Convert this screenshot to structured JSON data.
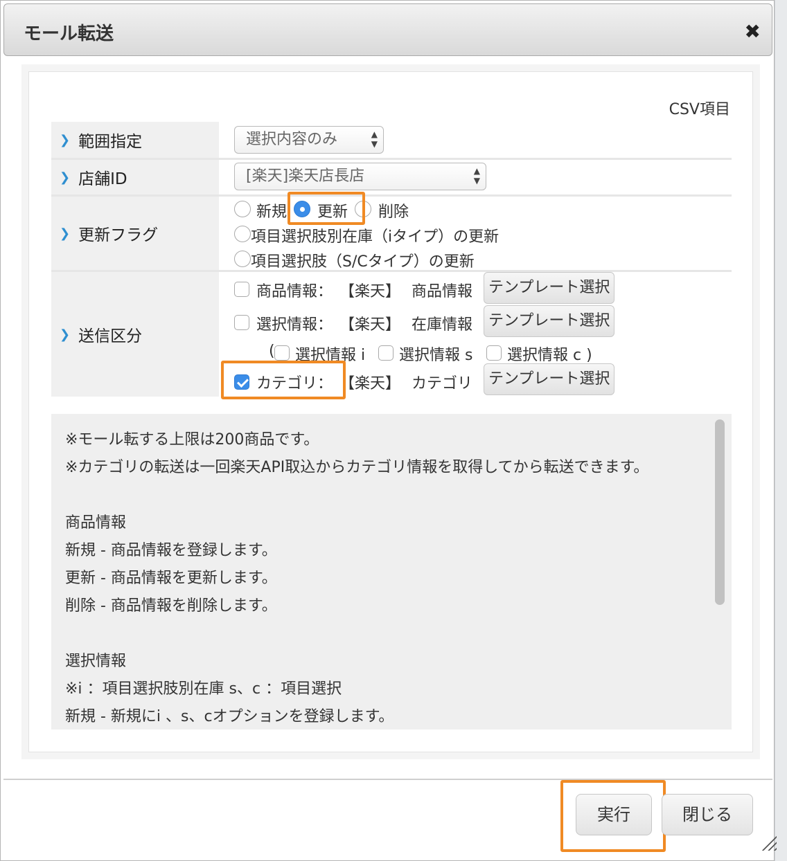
{
  "dialog": {
    "title": "モール転送",
    "close_icon": "close-icon"
  },
  "csv_label": "CSV項目",
  "form": {
    "range": {
      "label": "範囲指定",
      "value": "選択内容のみ"
    },
    "store": {
      "label": "店舗ID",
      "value": "[楽天]楽天店長店"
    },
    "update_flag": {
      "label": "更新フラグ",
      "options": [
        "新規",
        "更新",
        "削除",
        "項目選択肢別在庫（iタイプ）の更新",
        "項目選択肢（S/Cタイプ）の更新"
      ],
      "selected": "更新"
    },
    "send_type": {
      "label": "送信区分",
      "product": {
        "label": "商品情報：",
        "mall": "【楽天】",
        "template": "商品情報",
        "button": "テンプレート選択",
        "checked": false
      },
      "selection": {
        "label": "選択情報：",
        "mall": "【楽天】",
        "template": "在庫情報",
        "button": "テンプレート選択",
        "checked": false
      },
      "sub_open": "(",
      "sub_i": "選択情報 i",
      "sub_s": "選択情報 s",
      "sub_c": "選択情報 c )",
      "category": {
        "label": "カテゴリ：",
        "mall": "【楽天】",
        "template": "カテゴリ",
        "button": "テンプレート選択",
        "checked": true
      }
    }
  },
  "notes": [
    "※モール転する上限は200商品です。",
    "※カテゴリの転送は一回楽天API取込からカテゴリ情報を取得してから転送できます。",
    "",
    "商品情報",
    "新規 - 商品情報を登録します。",
    "更新 - 商品情報を更新します。",
    "削除 - 商品情報を削除します。",
    "",
    "選択情報",
    "※i ：項目選択肢別在庫 s、c ：項目選択",
    "新規 - 新規にi 、s、cオプションを登録します。"
  ],
  "footer": {
    "execute": "実行",
    "close": "閉じる"
  },
  "colors": {
    "highlight": "#f08a24",
    "accent": "#3b8de8",
    "label_bg": "#f0f0f0"
  }
}
